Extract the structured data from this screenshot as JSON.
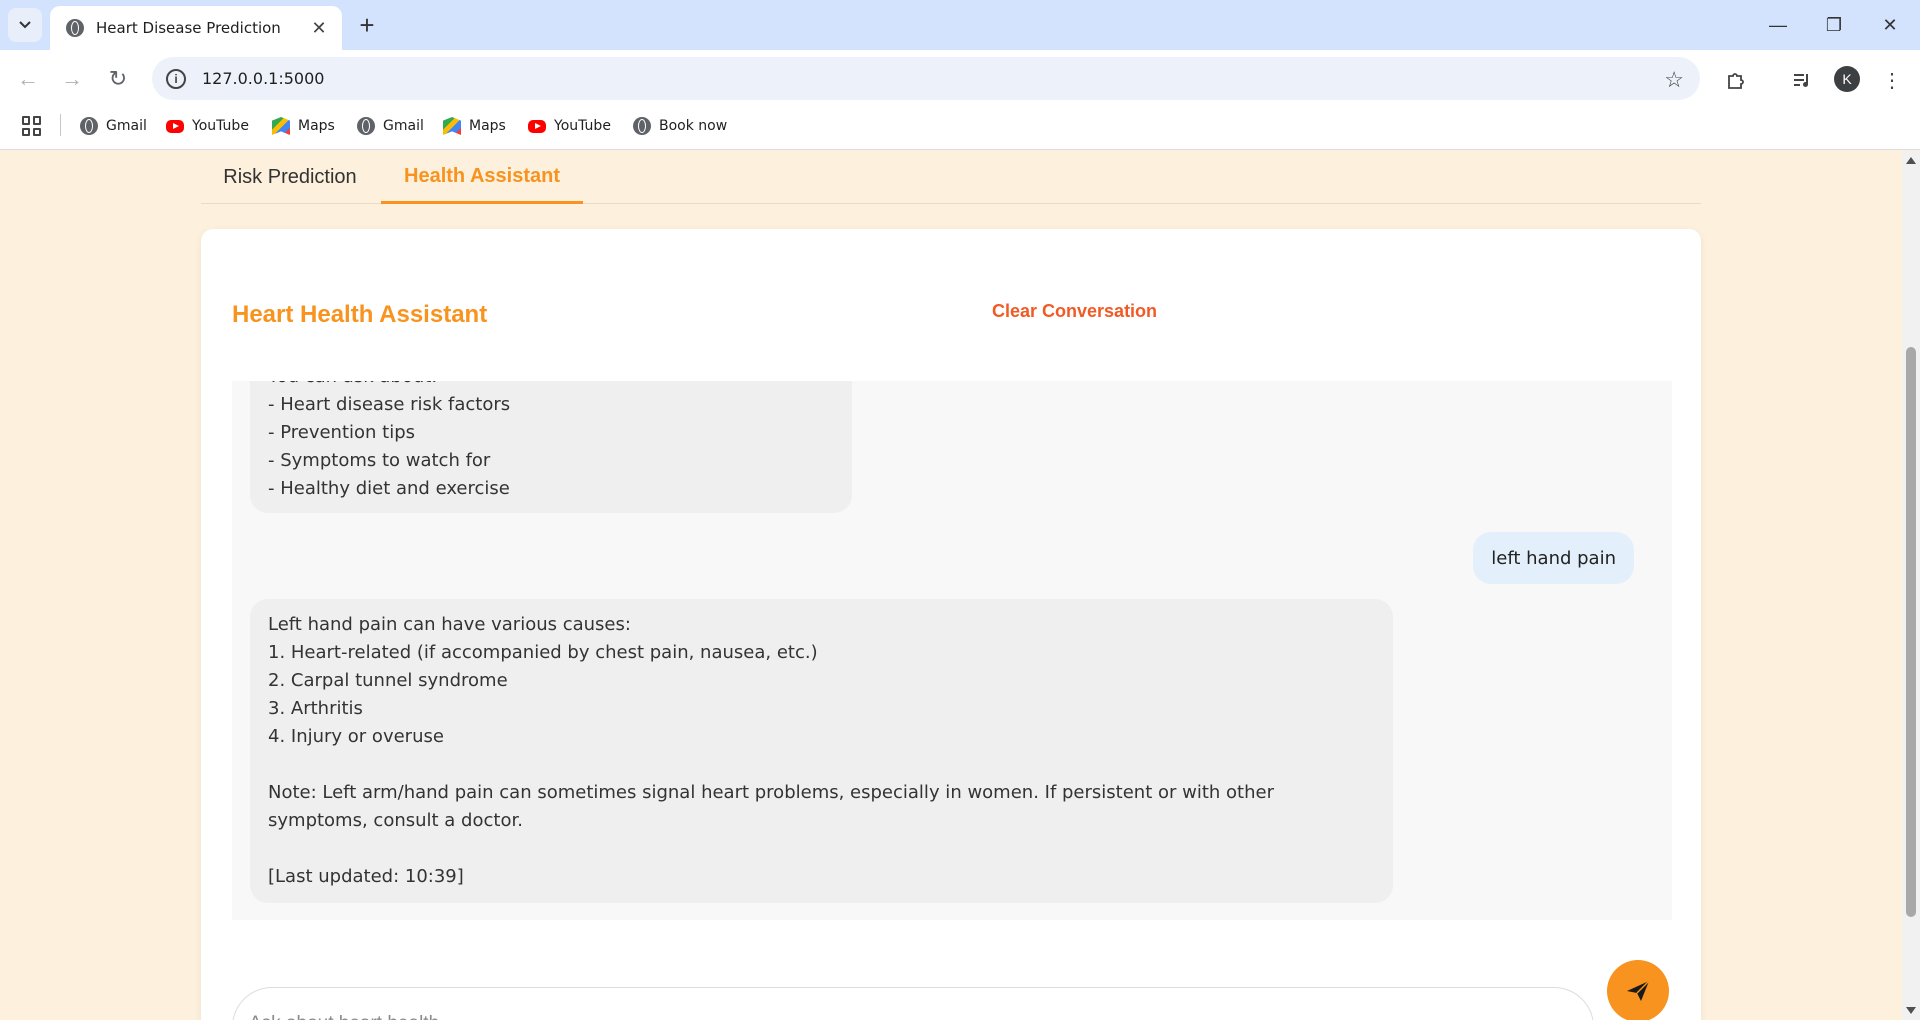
{
  "browser": {
    "tab_title": "Heart Disease Prediction",
    "url": "127.0.0.1:5000",
    "profile_initial": "K",
    "bookmarks": [
      {
        "label": "Gmail",
        "icon": "globe-icon"
      },
      {
        "label": "YouTube",
        "icon": "youtube-icon"
      },
      {
        "label": "Maps",
        "icon": "maps-icon"
      },
      {
        "label": "Gmail",
        "icon": "globe-icon"
      },
      {
        "label": "Maps",
        "icon": "maps-icon"
      },
      {
        "label": "YouTube",
        "icon": "youtube-icon"
      },
      {
        "label": "Book now",
        "icon": "globe-icon"
      }
    ]
  },
  "app": {
    "tabs": [
      {
        "label": "Risk Prediction",
        "active": false
      },
      {
        "label": "Health Assistant",
        "active": true
      }
    ],
    "assistant_title": "Heart Health Assistant",
    "clear_label": "Clear Conversation",
    "accent_color": "#f7931e",
    "clear_color": "#f15a24",
    "messages": [
      {
        "role": "assistant",
        "lines": [
          "You can ask about:",
          "- Heart disease risk factors",
          "- Prevention tips",
          "- Symptoms to watch for",
          "- Healthy diet and exercise"
        ]
      },
      {
        "role": "user",
        "text": "left hand pain"
      },
      {
        "role": "assistant",
        "lines": [
          "Left hand pain can have various causes:",
          "1. Heart-related (if accompanied by chest pain, nausea, etc.)",
          "2. Carpal tunnel syndrome",
          "3. Arthritis",
          "4. Injury or overuse",
          "",
          "Note: Left arm/hand pain can sometimes signal heart problems, especially in women. If persistent or with other symptoms, consult a doctor.",
          "",
          "[Last updated: 10:39]"
        ]
      }
    ],
    "input_placeholder": "Ask about heart health...",
    "input_value": ""
  }
}
